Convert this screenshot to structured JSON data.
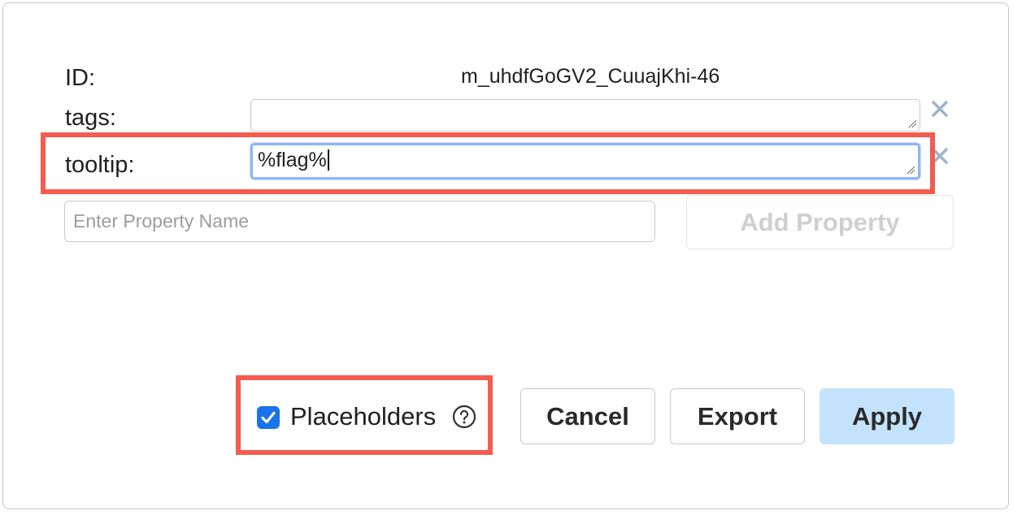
{
  "properties": {
    "id_label": "ID:",
    "id_value": "m_uhdfGoGV2_CuuajKhi-46",
    "tags_label": "tags:",
    "tags_value": "",
    "tooltip_label": "tooltip:",
    "tooltip_value": "%flag%"
  },
  "new_property": {
    "placeholder": "Enter Property Name",
    "value": "",
    "add_button_label": "Add Property"
  },
  "footer": {
    "placeholders_label": "Placeholders",
    "placeholders_checked": true,
    "cancel_label": "Cancel",
    "export_label": "Export",
    "apply_label": "Apply"
  },
  "icons": {
    "remove": "close-icon",
    "help": "question-circle-icon",
    "check": "checkmark-icon"
  },
  "colors": {
    "highlight": "#f65b4f",
    "focus_ring": "#8fb6f3",
    "apply_bg": "#c3e3fc",
    "checkbox": "#1a73e8",
    "remove_icon": "#9fb3cb"
  }
}
